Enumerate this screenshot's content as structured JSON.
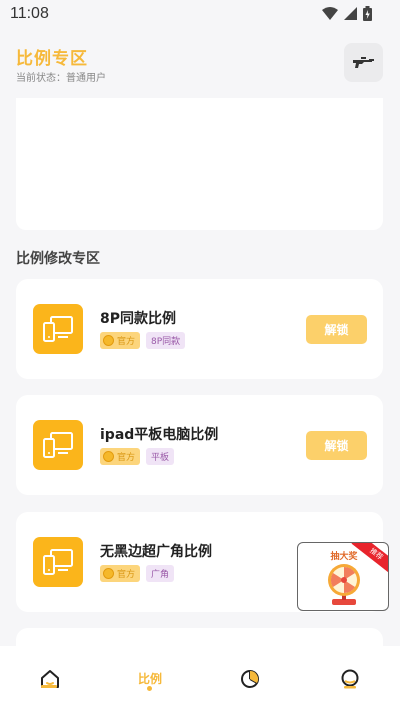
{
  "status_bar": {
    "time": "11:08"
  },
  "header": {
    "title": "比例专区",
    "status_text": "当前状态：普通用户"
  },
  "section": {
    "title": "比例修改专区"
  },
  "cards": [
    {
      "title": "8P同款比例",
      "tag_official": "官方",
      "tag_type": "8P同款",
      "button": "解锁"
    },
    {
      "title": "ipad平板电脑比例",
      "tag_official": "官方",
      "tag_type": "平板",
      "button": "解锁"
    },
    {
      "title": "无黑边超广角比例",
      "tag_official": "官方",
      "tag_type": "广角"
    }
  ],
  "float_ad": {
    "title": "抽大奖",
    "ribbon": "推荐"
  },
  "bottom_nav": {
    "active_label": "比例"
  },
  "colors": {
    "accent": "#f6b93b",
    "icon_bg": "#fbb51b",
    "button_bg": "#fcd06a",
    "tag_type_bg": "#f0e4f6"
  }
}
